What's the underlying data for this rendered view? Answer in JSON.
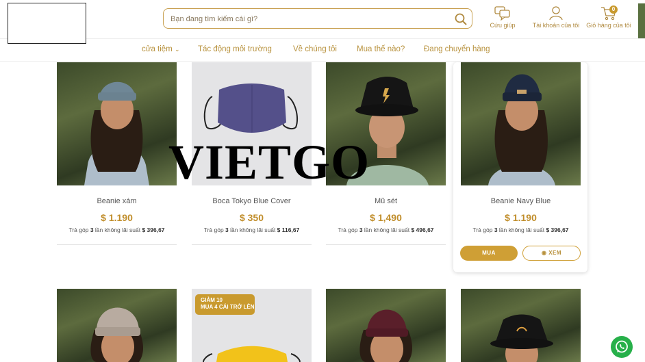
{
  "header": {
    "search_placeholder": "Bạn đang tìm kiếm cái gì?",
    "support_label": "Cứu giúp",
    "account_label": "Tài khoản của tôi",
    "cart_label": "Giỏ hàng của tôi",
    "cart_count": "0"
  },
  "nav": {
    "items": [
      "cửa tiệm",
      "Tác động môi trường",
      "Về chúng tôi",
      "Mua thế nào?",
      "Đang chuyển hàng"
    ]
  },
  "watermark": "VIETGO",
  "products_row1": [
    {
      "name": "Beanie xám",
      "price": "$ 1.190",
      "inst_prefix": "Trả góp ",
      "inst_count": "3",
      "inst_mid": " lần không lãi suất ",
      "inst_amount": "$ 396,67"
    },
    {
      "name": "Boca Tokyo Blue Cover",
      "price": "$ 350",
      "inst_prefix": "Trả góp ",
      "inst_count": "3",
      "inst_mid": " lần không lãi suất ",
      "inst_amount": "$ 116,67"
    },
    {
      "name": "Mũ sét",
      "price": "$ 1,490",
      "inst_prefix": "Trả góp ",
      "inst_count": "3",
      "inst_mid": " lần không lãi suất ",
      "inst_amount": "$ 496,67"
    },
    {
      "name": "Beanie Navy Blue",
      "price": "$ 1.190",
      "inst_prefix": "Trả góp ",
      "inst_count": "3",
      "inst_mid": " lần không lãi suất ",
      "inst_amount": "$ 396,67"
    }
  ],
  "buttons": {
    "buy": "MUA",
    "view": "XEM"
  },
  "promo": {
    "line1": "GIẢM 10",
    "line2": "MUA 4 CÁI TRỞ LÊN"
  },
  "colors": {
    "accent": "#c99a2e",
    "whatsapp": "#27b04a"
  }
}
